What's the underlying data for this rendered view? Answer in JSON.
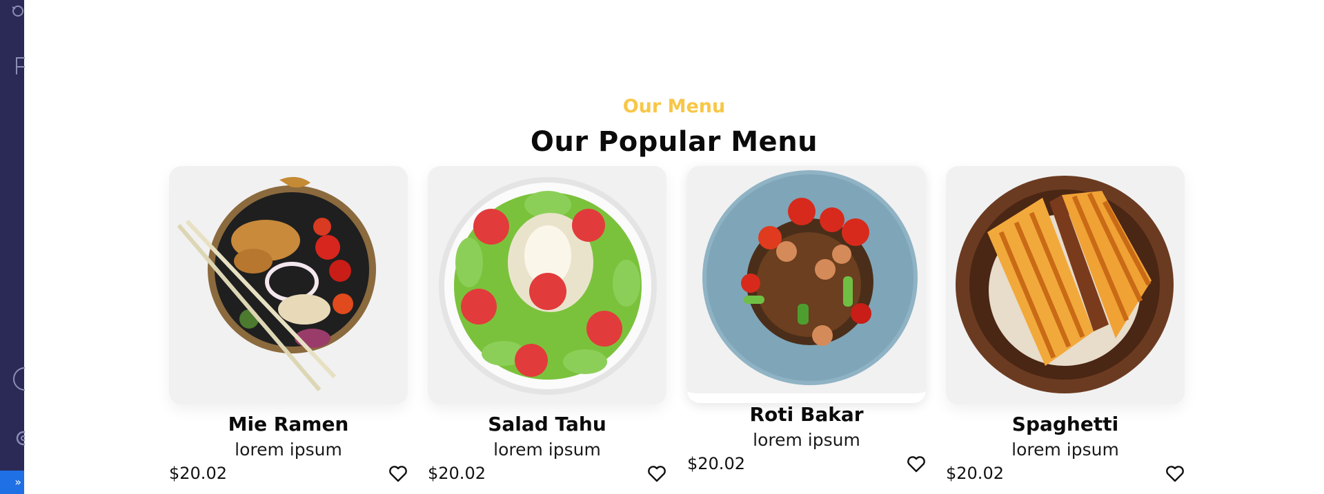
{
  "editor": {
    "remote_indicator_glyph": "»"
  },
  "section": {
    "subtitle": "Our Menu",
    "title": "Our Popular Menu"
  },
  "menu_items": [
    {
      "name": "Mie Ramen",
      "description": "lorem ipsum",
      "price": "$20.02",
      "image_icon": "ramen-bowl-image"
    },
    {
      "name": "Salad Tahu",
      "description": "lorem ipsum",
      "price": "$20.02",
      "image_icon": "salad-bowl-image"
    },
    {
      "name": "Roti Bakar",
      "description": "lorem ipsum",
      "price": "$20.02",
      "image_icon": "noodle-plate-image"
    },
    {
      "name": "Spaghetti",
      "description": "lorem ipsum",
      "price": "$20.02",
      "image_icon": "toast-plate-image"
    }
  ],
  "colors": {
    "accent": "#f7c747",
    "card_bg": "#f1f1f1",
    "activity_bar": "#2b2a56",
    "remote_indicator": "#1f6fe5"
  }
}
